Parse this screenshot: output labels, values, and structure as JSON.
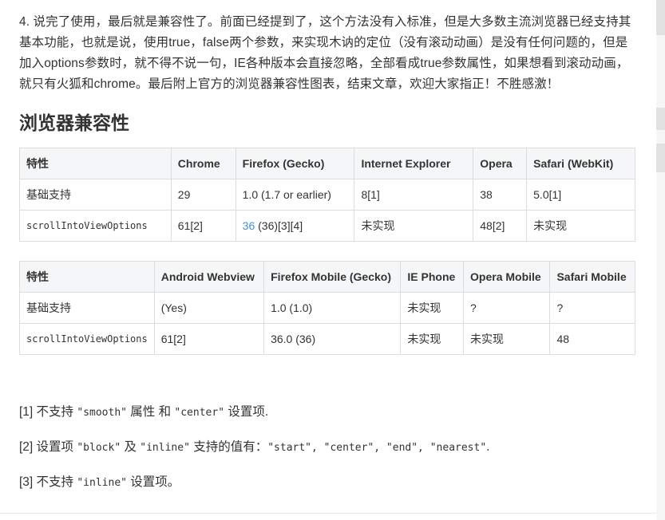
{
  "intro": "4. 说完了使用，最后就是兼容性了。前面已经提到了，这个方法没有入标准，但是大多数主流浏览器已经支持其基本功能，也就是说，使用true，false两个参数，来实现木讷的定位（没有滚动动画）是没有任何问题的，但是加入options参数时，就不得不说一句，IE各种版本会直接忽略，全部看成true参数属性，如果想看到滚动动画，就只有火狐和chrome。最后附上官方的浏览器兼容性图表，结束文章，欢迎大家指正！不胜感激！",
  "heading": "浏览器兼容性",
  "desktop_table": {
    "headers": [
      "特性",
      "Chrome",
      "Firefox (Gecko)",
      "Internet Explorer",
      "Opera",
      "Safari (WebKit)"
    ],
    "row1": [
      "基础支持",
      "29",
      "1.0 (1.7 or earlier)",
      "8[1]",
      "38",
      "5.0[1]"
    ],
    "row2": {
      "feature": "scrollIntoViewOptions",
      "chrome": "61[2]",
      "firefox_link": "36",
      "firefox_rest": " (36)[3][4]",
      "ie": "未实现",
      "opera": "48[2]",
      "safari": "未实现"
    }
  },
  "mobile_table": {
    "headers": [
      "特性",
      "Android Webview",
      "Firefox Mobile (Gecko)",
      "IE Phone",
      "Opera Mobile",
      "Safari Mobile"
    ],
    "row1": [
      "基础支持",
      "(Yes)",
      "1.0 (1.0)",
      "未实现",
      "?",
      "?"
    ],
    "row2": [
      "scrollIntoViewOptions",
      "61[2]",
      "36.0 (36)",
      "未实现",
      "未实现",
      "48"
    ]
  },
  "notes": {
    "n1": {
      "prefix": "[1] 不支持 ",
      "c1": "\"smooth\"",
      "mid": " 属性 和 ",
      "c2": "\"center\"",
      "suffix": " 设置项."
    },
    "n2": {
      "prefix": "[2] 设置项 ",
      "c1": "\"block\"",
      "mid": " 及 ",
      "c2": "\"inline\"",
      "mid2": " 支持的值有：",
      "c3": "\"start\", \"center\", \"end\", \"nearest\"",
      "suffix": "."
    },
    "n3": {
      "prefix": "[3] 不支持 ",
      "c1": "\"inline\"",
      "suffix": " 设置项。"
    }
  }
}
